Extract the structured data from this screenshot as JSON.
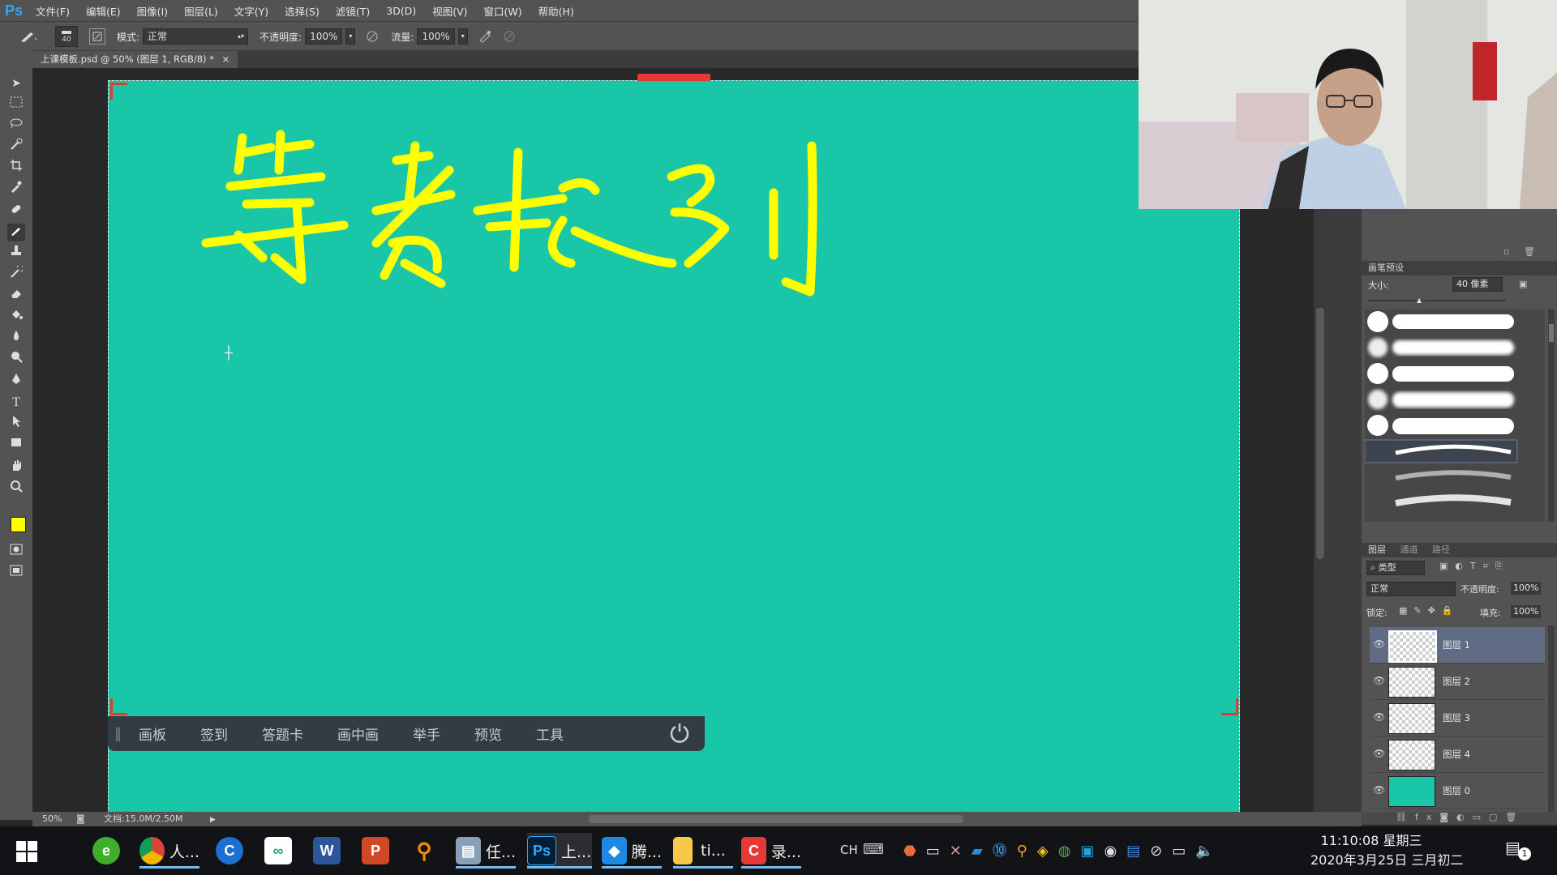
{
  "app": {
    "logo": "Ps"
  },
  "menu": [
    "文件(F)",
    "编辑(E)",
    "图像(I)",
    "图层(L)",
    "文字(Y)",
    "选择(S)",
    "滤镜(T)",
    "3D(D)",
    "视图(V)",
    "窗口(W)",
    "帮助(H)"
  ],
  "options": {
    "brush_size": "40",
    "mode_label": "模式:",
    "mode_value": "正常",
    "opacity_label": "不透明度:",
    "opacity_value": "100%",
    "flow_label": "流量:",
    "flow_value": "100%"
  },
  "document": {
    "tab_title": "上课模板.psd @ 50% (图层 1, RGB/8) *",
    "close": "×"
  },
  "canvas": {
    "background_color": "#19c6a8",
    "handwriting_color": "#ffff00",
    "float_toolbar": [
      "画板",
      "签到",
      "答题卡",
      "画中画",
      "举手",
      "预览",
      "工具"
    ]
  },
  "brush_panel": {
    "title": "画笔预设",
    "size_label": "大小:",
    "size_value": "40 像素"
  },
  "layers_panel": {
    "tabs": [
      "图层",
      "通道",
      "路径"
    ],
    "kind_filter": "类型",
    "blend_mode": "正常",
    "opacity_label": "不透明度:",
    "opacity_value": "100%",
    "lock_label": "锁定:",
    "fill_label": "填充:",
    "fill_value": "100%",
    "layers": [
      {
        "name": "图层 1",
        "selected": true
      },
      {
        "name": "图层 2",
        "selected": false
      },
      {
        "name": "图层 3",
        "selected": false
      },
      {
        "name": "图层 4",
        "selected": false
      },
      {
        "name": "图层 0",
        "selected": false,
        "fill": "#19c6a8"
      }
    ]
  },
  "status": {
    "zoom": "50%",
    "doc_info": "文档:15.0M/2.50M"
  },
  "taskbar": {
    "apps": [
      {
        "label": "人...",
        "icon": "chrome-icon"
      },
      {
        "label": "任...",
        "icon": "task-icon"
      },
      {
        "label": "上...",
        "icon": "photoshop-icon"
      },
      {
        "label": "腾...",
        "icon": "tencent-icon"
      },
      {
        "label": "ti...",
        "icon": "folder-icon"
      },
      {
        "label": "录...",
        "icon": "recorder-icon"
      }
    ],
    "input_method": "CH",
    "time": "11:10:08 星期三",
    "date": "2020年3月25日 三月初二",
    "notification_count": "1"
  }
}
